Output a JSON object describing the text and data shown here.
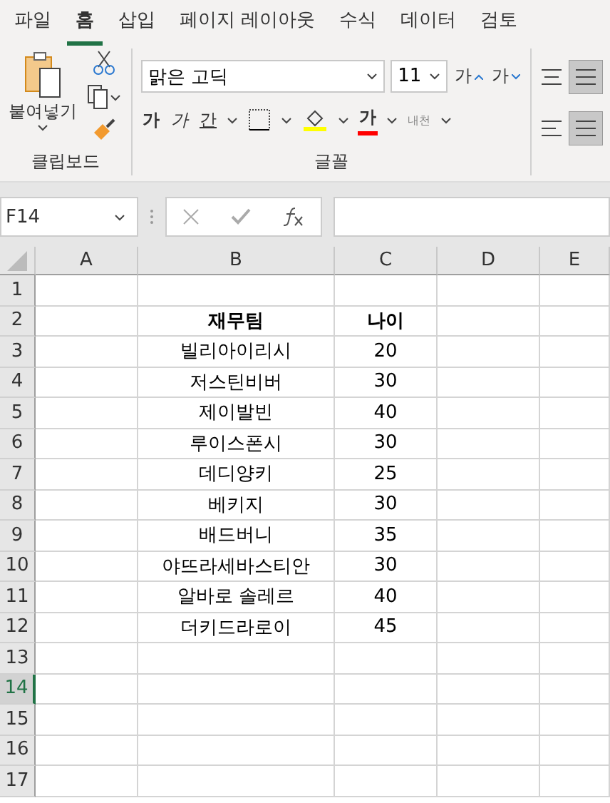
{
  "menu_tabs": [
    {
      "label": "파일",
      "selected": false
    },
    {
      "label": "홈",
      "selected": true
    },
    {
      "label": "삽입",
      "selected": false
    },
    {
      "label": "페이지 레이아웃",
      "selected": false
    },
    {
      "label": "수식",
      "selected": false
    },
    {
      "label": "데이터",
      "selected": false
    },
    {
      "label": "검토",
      "selected": false
    }
  ],
  "ribbon": {
    "clipboard": {
      "paste_label": "붙여넣기",
      "group_label": "클립보드"
    },
    "font": {
      "font_name": "맑은 고딕",
      "font_size": "11",
      "grow_label": "가",
      "shrink_label": "가",
      "bold_label": "가",
      "italic_label": "가",
      "underline_label": "간",
      "font_color_label": "가",
      "phonetic_label": "내천",
      "group_label": "글꼴"
    }
  },
  "name_box": "F14",
  "columns": [
    "A",
    "B",
    "C",
    "D",
    "E"
  ],
  "rows": [
    {
      "number": "1",
      "selected": false,
      "cells": {}
    },
    {
      "number": "2",
      "selected": false,
      "header": true,
      "cells": {
        "B": "재무팀",
        "C": "나이"
      }
    },
    {
      "number": "3",
      "selected": false,
      "header": false,
      "cells": {
        "B": "빌리아이리시",
        "C": "20"
      }
    },
    {
      "number": "4",
      "selected": false,
      "header": false,
      "cells": {
        "B": "저스틴비버",
        "C": "30"
      }
    },
    {
      "number": "5",
      "selected": false,
      "header": false,
      "cells": {
        "B": "제이발빈",
        "C": "40"
      }
    },
    {
      "number": "6",
      "selected": false,
      "header": false,
      "cells": {
        "B": "루이스폰시",
        "C": "30"
      }
    },
    {
      "number": "7",
      "selected": false,
      "header": false,
      "cells": {
        "B": "데디양키",
        "C": "25"
      }
    },
    {
      "number": "8",
      "selected": false,
      "header": false,
      "cells": {
        "B": "베키지",
        "C": "30"
      }
    },
    {
      "number": "9",
      "selected": false,
      "header": false,
      "cells": {
        "B": "배드버니",
        "C": "35"
      }
    },
    {
      "number": "10",
      "selected": false,
      "header": false,
      "cells": {
        "B": "야뜨라세바스티안",
        "C": "30"
      }
    },
    {
      "number": "11",
      "selected": false,
      "header": false,
      "cells": {
        "B": "알바로 솔레르",
        "C": "40"
      }
    },
    {
      "number": "12",
      "selected": false,
      "header": false,
      "cells": {
        "B": "더키드라로이",
        "C": "45"
      }
    },
    {
      "number": "13",
      "selected": false,
      "cells": {}
    },
    {
      "number": "14",
      "selected": true,
      "cells": {}
    },
    {
      "number": "15",
      "selected": false,
      "cells": {}
    },
    {
      "number": "16",
      "selected": false,
      "cells": {}
    },
    {
      "number": "17",
      "selected": false,
      "cells": {}
    }
  ]
}
